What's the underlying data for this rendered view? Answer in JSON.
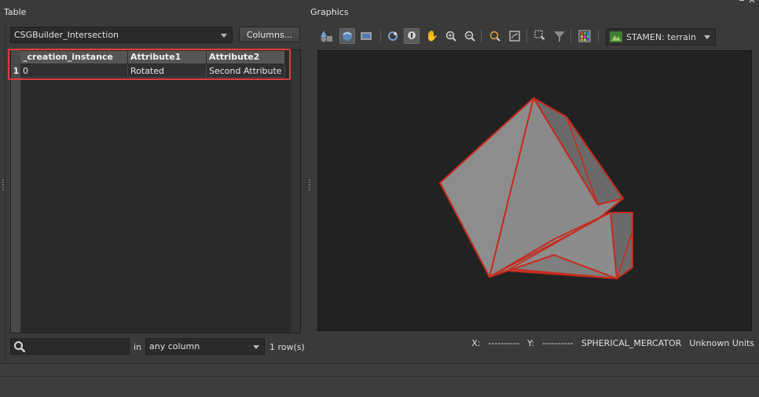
{
  "table_panel": {
    "title": "Table",
    "dataset_select": "CSGBuilder_Intersection",
    "columns_button": "Columns...",
    "columns": [
      "_creation_instance",
      "Attribute1",
      "Attribute2"
    ],
    "rows": [
      {
        "row_number": "1",
        "cells": [
          "0",
          "Rotated",
          "Second Attribute"
        ]
      }
    ],
    "search": {
      "placeholder": "",
      "value": ""
    },
    "in_label": "in",
    "column_scope": "any column",
    "row_count": "1 row(s)"
  },
  "graphics_panel": {
    "title": "Graphics",
    "toolbar_icons": [
      "select-features-icon",
      "orbit-icon",
      "camera-icon",
      "sync-icon",
      "identify-icon",
      "pan-icon",
      "zoom-in-icon",
      "zoom-out-icon",
      "magnifier-icon",
      "zoom-extent-icon",
      "selection-tool-icon",
      "filter-icon",
      "color-grid-icon"
    ],
    "basemap": "STAMEN: terrain",
    "status": {
      "x_label": "X:",
      "x_value": "----------",
      "y_label": "Y:",
      "y_value": "----------",
      "projection": "SPHERICAL_MERCATOR",
      "units": "Unknown Units"
    }
  },
  "colors": {
    "highlight": "#e03c3c",
    "shape_fill": "#8c8c8c",
    "shape_edge": "#c62b1c"
  }
}
